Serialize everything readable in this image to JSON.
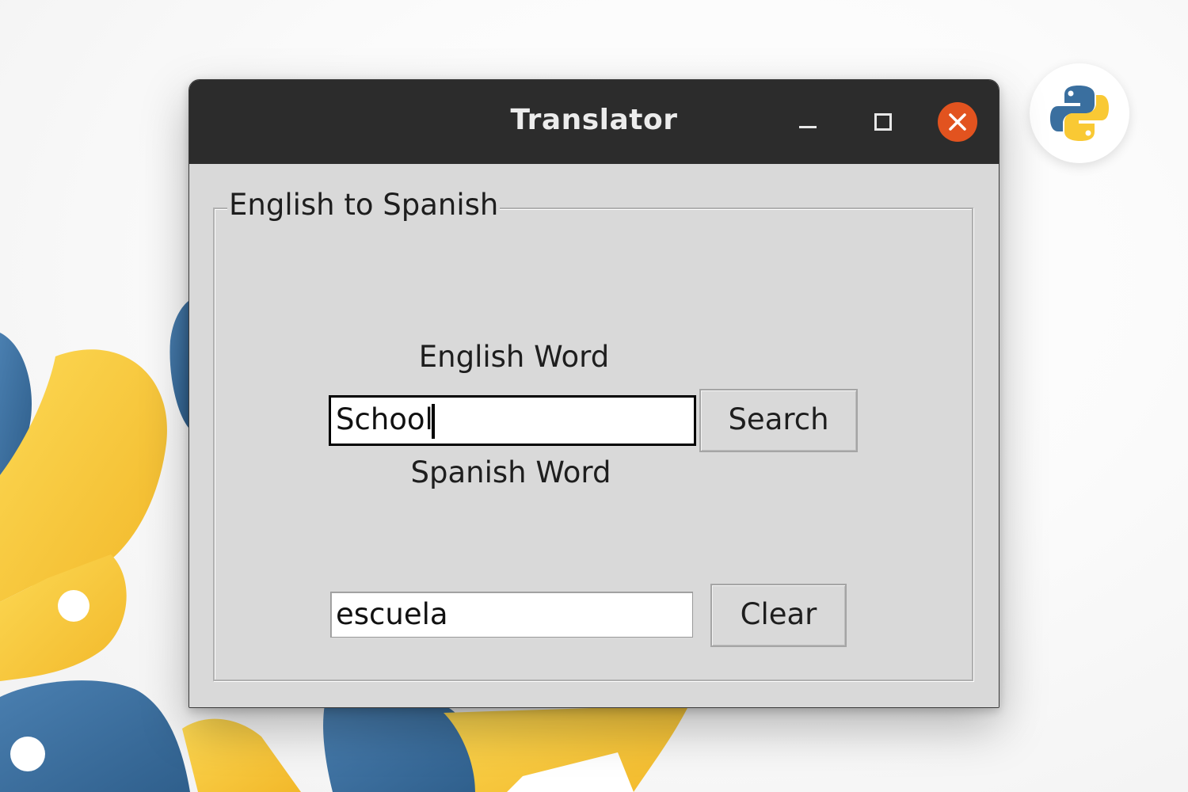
{
  "window": {
    "title": "Translator",
    "controls": {
      "minimize": "minimize-icon",
      "maximize": "maximize-icon",
      "close": "close-icon"
    }
  },
  "group": {
    "title": "English to Spanish"
  },
  "english": {
    "label": "English Word",
    "value": "School"
  },
  "spanish": {
    "label": "Spanish Word",
    "value": "escuela"
  },
  "buttons": {
    "search": "Search",
    "clear": "Clear"
  },
  "colors": {
    "titlebar": "#2c2c2c",
    "close_button": "#e2531f",
    "window_bg": "#d9d9d9",
    "python_blue": "#3a6f9f",
    "python_yellow": "#f9c934"
  },
  "badge": {
    "icon": "python-logo-icon"
  }
}
